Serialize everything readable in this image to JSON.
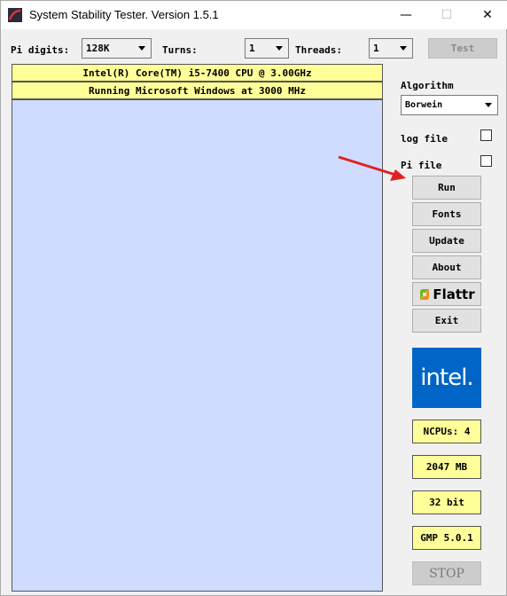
{
  "window": {
    "title": "System Stability Tester. Version 1.5.1",
    "minimize": "—",
    "maximize": "☐",
    "close": "✕"
  },
  "toolbar": {
    "pi_digits_label": "Pi digits:",
    "pi_digits_value": "128K",
    "turns_label": "Turns:",
    "turns_value": "1",
    "threads_label": "Threads:",
    "threads_value": "1",
    "test_label": "Test"
  },
  "output": {
    "cpu_line": "Intel(R) Core(TM) i5-7400 CPU @ 3.00GHz",
    "os_line": "Running Microsoft Windows at 3000 MHz"
  },
  "sidebar": {
    "algorithm_label": "Algorithm",
    "algorithm_value": "Borwein",
    "log_file_label": "log file",
    "pi_file_label": "Pi file",
    "buttons": {
      "run": "Run",
      "fonts": "Fonts",
      "update": "Update",
      "about": "About",
      "flattr": "Flattr",
      "exit": "Exit"
    },
    "cpu_logo_text": "intel.",
    "info": {
      "ncpus": "NCPUs: 4",
      "memory": "2047 MB",
      "bits": "32 bit",
      "gmp": "GMP 5.0.1"
    },
    "stop_label": "STOP"
  },
  "colors": {
    "banner": "#ffff99",
    "output_bg": "#cfdcff",
    "intel_blue": "#0065c6",
    "flattr_green": "#7ab51d"
  }
}
